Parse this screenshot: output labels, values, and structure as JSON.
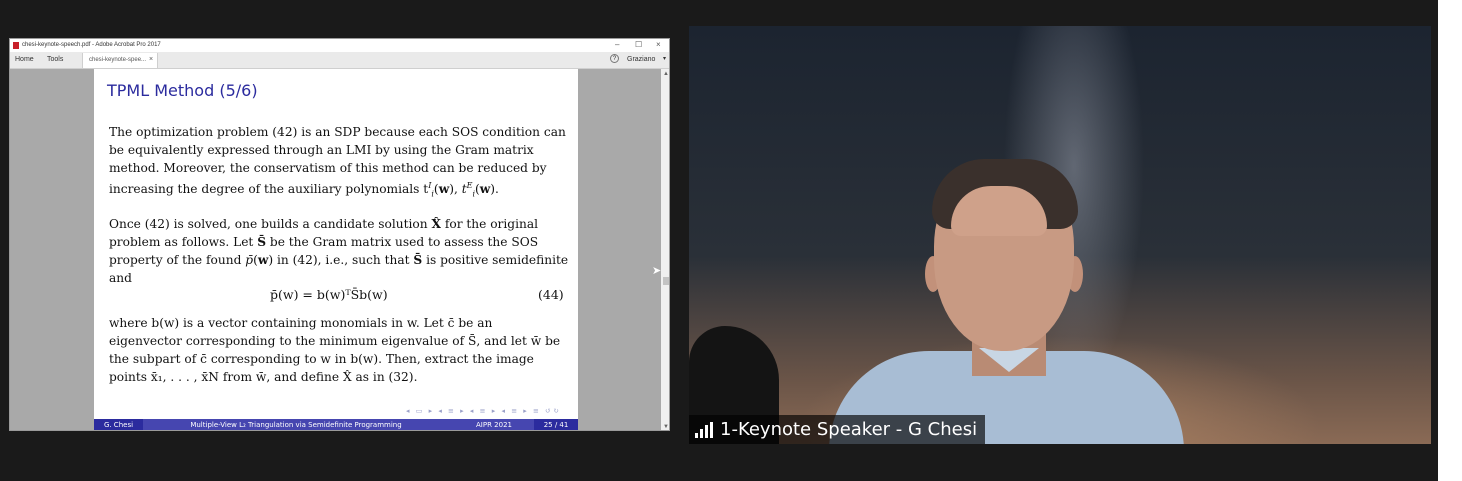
{
  "acrobat": {
    "title": "chesi-keynote-speech.pdf - Adobe Acrobat Pro 2017",
    "menu": {
      "home": "Home",
      "tools": "Tools"
    },
    "tab_label": "chesi-keynote-spee...",
    "tab_close": "×",
    "help": "?",
    "user": "Graziano",
    "window_controls": [
      "–",
      "☐",
      "×"
    ]
  },
  "slide": {
    "title": "TPML Method (5/6)",
    "p1": "The optimization problem (42) is an SDP because each SOS condition can be equivalently expressed through an LMI by using the Gram matrix method. Moreover, the conservatism of this method can be reduced by increasing the degree of the auxiliary polynomials t",
    "p2_prefix": "Once (42) is solved, one builds a candidate solution ",
    "p2_mid1": " for the original problem as follows. Let ",
    "p2_mid2": " be the Gram matrix used to assess the SOS property of the found ",
    "p2_mid3": " in (42), i.e., such that ",
    "p2_suffix": " is positive semidefinite and",
    "equation": "p̄(w) = b(w)ᵀS̄b(w)",
    "equation_number": "(44)",
    "p3": "where b(w) is a vector containing monomials in w. Let c̄ be an eigenvector corresponding to the minimum eigenvalue of S̄, and let w̄ be the subpart of c̄ corresponding to w in b(w). Then, extract the image points x̄₁, . . . , x̄N from w̄, and define X̂ as in (32).",
    "footer": {
      "author": "G. Chesi",
      "talk": "Multiple-View L₂ Triangulation via Semidefinite Programming",
      "conf": "AIPR 2021",
      "page": "25 / 41"
    }
  },
  "video": {
    "speaker_label": "1-Keynote Speaker - G Chesi"
  }
}
